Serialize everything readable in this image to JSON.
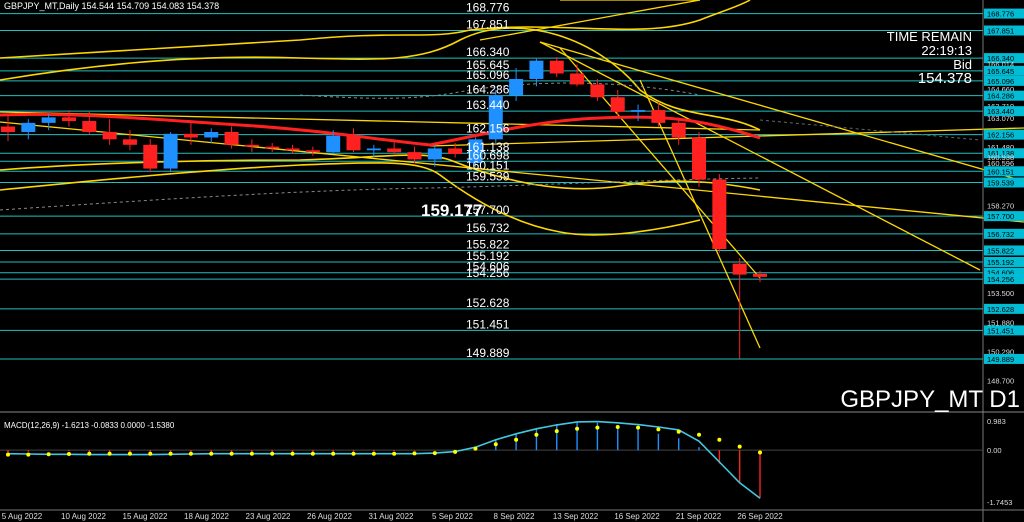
{
  "header": {
    "symbol_line": "GBPJPY_MT,Daily  154.544 154.709 154.083 154.378"
  },
  "info_panel": {
    "time_remain_label": "TIME REMAIN",
    "time_remain_value": "22:19:13",
    "bid_label": "Bid",
    "bid_value": "154.378"
  },
  "symbol_watermark": "GBPJPY_MT D1",
  "highlight_level": "159.177",
  "colors": {
    "background": "#000000",
    "up_candle": "#1e90ff",
    "down_candle": "#ff2020",
    "level_line": "#20c0c0",
    "trend_line": "#ffd700",
    "macd_signal": "#ffff00",
    "macd_main": "#40c8e0",
    "axis_label_bg": "#00bcd4"
  },
  "chart_data": {
    "type": "candlestick",
    "symbol": "GBPJPY_MT",
    "timeframe": "Daily",
    "ylim": [
      148.3,
      169.3
    ],
    "x_dates": [
      "5 Aug 2022",
      "10 Aug 2022",
      "15 Aug 2022",
      "18 Aug 2022",
      "23 Aug 2022",
      "26 Aug 2022",
      "31 Aug 2022",
      "5 Sep 2022",
      "8 Sep 2022",
      "13 Sep 2022",
      "16 Sep 2022",
      "21 Sep 2022",
      "26 Sep 2022"
    ],
    "candles": [
      {
        "o": 162.6,
        "h": 163.2,
        "l": 161.8,
        "c": 162.3
      },
      {
        "o": 162.3,
        "h": 163.0,
        "l": 161.9,
        "c": 162.8
      },
      {
        "o": 162.8,
        "h": 163.3,
        "l": 162.4,
        "c": 163.1
      },
      {
        "o": 163.1,
        "h": 163.5,
        "l": 162.6,
        "c": 162.9
      },
      {
        "o": 162.9,
        "h": 163.4,
        "l": 162.2,
        "c": 162.3
      },
      {
        "o": 162.3,
        "h": 163.0,
        "l": 161.6,
        "c": 161.9
      },
      {
        "o": 161.9,
        "h": 162.4,
        "l": 161.3,
        "c": 161.6
      },
      {
        "o": 161.6,
        "h": 161.9,
        "l": 160.1,
        "c": 160.3
      },
      {
        "o": 160.3,
        "h": 162.3,
        "l": 160.1,
        "c": 162.2
      },
      {
        "o": 162.2,
        "h": 162.8,
        "l": 161.6,
        "c": 162.0
      },
      {
        "o": 162.0,
        "h": 162.5,
        "l": 161.7,
        "c": 162.3
      },
      {
        "o": 162.3,
        "h": 162.6,
        "l": 161.4,
        "c": 161.6
      },
      {
        "o": 161.6,
        "h": 161.9,
        "l": 161.2,
        "c": 161.5
      },
      {
        "o": 161.5,
        "h": 161.7,
        "l": 161.2,
        "c": 161.4
      },
      {
        "o": 161.4,
        "h": 161.6,
        "l": 161.1,
        "c": 161.3
      },
      {
        "o": 161.3,
        "h": 161.5,
        "l": 161.0,
        "c": 161.2
      },
      {
        "o": 161.2,
        "h": 162.4,
        "l": 161.1,
        "c": 162.1
      },
      {
        "o": 162.1,
        "h": 162.5,
        "l": 161.2,
        "c": 161.3
      },
      {
        "o": 161.3,
        "h": 161.6,
        "l": 160.9,
        "c": 161.4
      },
      {
        "o": 161.4,
        "h": 161.8,
        "l": 161.1,
        "c": 161.2
      },
      {
        "o": 161.2,
        "h": 161.5,
        "l": 160.6,
        "c": 160.8
      },
      {
        "o": 160.8,
        "h": 161.6,
        "l": 160.4,
        "c": 161.4
      },
      {
        "o": 161.4,
        "h": 161.7,
        "l": 160.9,
        "c": 161.1
      },
      {
        "o": 160.6,
        "h": 162.0,
        "l": 160.4,
        "c": 161.9
      },
      {
        "o": 161.9,
        "h": 164.6,
        "l": 161.7,
        "c": 164.3
      },
      {
        "o": 164.3,
        "h": 165.8,
        "l": 164.0,
        "c": 165.2
      },
      {
        "o": 165.2,
        "h": 166.3,
        "l": 164.8,
        "c": 166.2
      },
      {
        "o": 166.2,
        "h": 166.4,
        "l": 165.3,
        "c": 165.5
      },
      {
        "o": 165.5,
        "h": 166.0,
        "l": 164.8,
        "c": 164.9
      },
      {
        "o": 164.9,
        "h": 165.2,
        "l": 164.0,
        "c": 164.2
      },
      {
        "o": 164.2,
        "h": 164.6,
        "l": 163.2,
        "c": 163.4
      },
      {
        "o": 163.4,
        "h": 163.8,
        "l": 162.9,
        "c": 163.5
      },
      {
        "o": 163.5,
        "h": 163.9,
        "l": 162.6,
        "c": 162.8
      },
      {
        "o": 162.8,
        "h": 163.1,
        "l": 161.6,
        "c": 162.0
      },
      {
        "o": 162.0,
        "h": 162.3,
        "l": 159.3,
        "c": 159.7
      },
      {
        "o": 159.7,
        "h": 160.0,
        "l": 155.7,
        "c": 155.9
      },
      {
        "o": 155.1,
        "h": 155.4,
        "l": 149.9,
        "c": 154.5
      },
      {
        "o": 154.544,
        "h": 154.709,
        "l": 154.083,
        "c": 154.378
      }
    ],
    "horizontal_levels": [
      168.776,
      167.851,
      166.34,
      165.645,
      165.096,
      164.286,
      163.44,
      162.156,
      161.138,
      160.698,
      160.151,
      159.539,
      157.7,
      156.732,
      155.822,
      155.192,
      154.606,
      154.256,
      152.628,
      151.451,
      149.889
    ],
    "price_axis_ticks": [
      "168.776",
      "167.851",
      "166.340",
      "166.014",
      "165.645",
      "165.096",
      "164.660",
      "164.286",
      "163.719",
      "163.440",
      "163.070",
      "162.156",
      "161.480",
      "161.138",
      "160.938",
      "160.596",
      "160.151",
      "159.539",
      "158.270",
      "157.700",
      "156.732",
      "155.822",
      "155.192",
      "154.606",
      "154.256",
      "153.500",
      "152.628",
      "151.880",
      "151.451",
      "150.290",
      "149.889",
      "148.700"
    ],
    "macd": {
      "label": "MACD(12,26,9) -1.6213 -0.0833 0.0000 -1.5380",
      "ylim": [
        -1.95,
        1.15
      ],
      "axis_ticks": [
        "0.983",
        "0.00",
        "-1.7453"
      ],
      "hist": [
        -0.1,
        -0.05,
        0.0,
        -0.03,
        -0.1,
        -0.12,
        -0.14,
        -0.16,
        -0.15,
        -0.14,
        -0.13,
        -0.12,
        -0.11,
        -0.1,
        -0.09,
        -0.08,
        -0.06,
        -0.05,
        -0.04,
        -0.03,
        -0.02,
        -0.01,
        0.0,
        0.05,
        0.35,
        0.55,
        0.75,
        0.88,
        0.95,
        0.92,
        0.82,
        0.7,
        0.55,
        0.4,
        0.1,
        -0.45,
        -1.1,
        -1.62
      ],
      "signal": [
        -0.15,
        -0.15,
        -0.14,
        -0.13,
        -0.12,
        -0.12,
        -0.12,
        -0.12,
        -0.12,
        -0.12,
        -0.12,
        -0.12,
        -0.12,
        -0.12,
        -0.12,
        -0.12,
        -0.12,
        -0.12,
        -0.12,
        -0.12,
        -0.11,
        -0.1,
        -0.06,
        0.05,
        0.2,
        0.35,
        0.52,
        0.64,
        0.72,
        0.76,
        0.78,
        0.76,
        0.7,
        0.62,
        0.52,
        0.35,
        0.12,
        -0.08
      ],
      "main": [
        -0.12,
        -0.13,
        -0.14,
        -0.14,
        -0.15,
        -0.15,
        -0.15,
        -0.15,
        -0.14,
        -0.13,
        -0.12,
        -0.12,
        -0.12,
        -0.12,
        -0.12,
        -0.12,
        -0.12,
        -0.12,
        -0.12,
        -0.12,
        -0.12,
        -0.1,
        -0.05,
        0.1,
        0.35,
        0.55,
        0.72,
        0.85,
        0.95,
        0.96,
        0.92,
        0.86,
        0.78,
        0.68,
        0.3,
        -0.4,
        -1.1,
        -1.62
      ]
    }
  }
}
